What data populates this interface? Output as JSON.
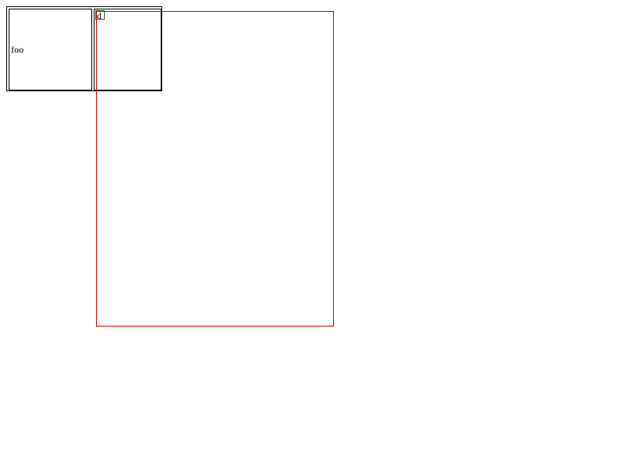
{
  "table": {
    "left_cell_text": "foo",
    "right_cell_text": "d"
  },
  "colors": {
    "outline": "#000000",
    "overlay_red": "#d00000",
    "overlay_green": "#1a7a1a"
  }
}
